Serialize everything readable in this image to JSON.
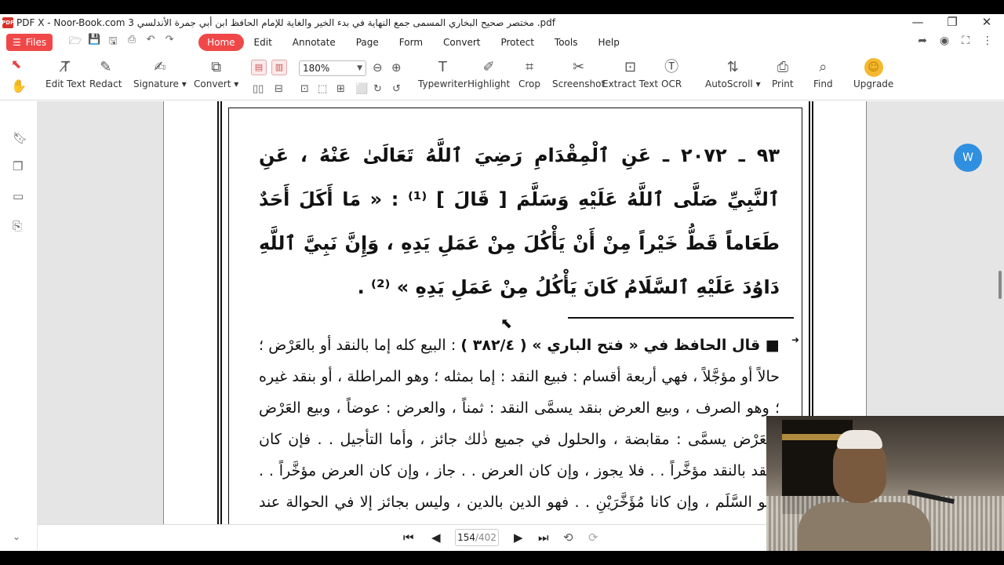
{
  "window": {
    "logo_text": "PDF",
    "title": "PDF X - Noor-Book.com  مختصر صحيح البخاري المسمى جمع النهاية في بدء الخير والغاية للإمام الحافظ ابن أبي جمرة الأندلسي 3 .pdf",
    "btn_min": "—",
    "btn_max": "❐",
    "btn_close": "✕"
  },
  "menubar": {
    "files_label": "Files",
    "items": [
      "Home",
      "Edit",
      "Annotate",
      "Page",
      "Form",
      "Convert",
      "Protect",
      "Tools",
      "Help"
    ],
    "active": "Home"
  },
  "toolbar": {
    "edit_text": "Edit Text",
    "redact": "Redact",
    "signature": "Signature ▾",
    "convert": "Convert ▾",
    "zoom": "180%",
    "typewriter": "Typewriter",
    "highlight": "Highlight",
    "crop": "Crop",
    "screenshot": "Screenshot",
    "extract_text": "Extract Text",
    "ocr": "OCR",
    "autoscroll": "AutoScroll ▾",
    "print": "Print",
    "find": "Find",
    "upgrade": "Upgrade"
  },
  "document": {
    "hadith": "٩٣ ـ ٢٠٧٢ ـ عَنِ ٱلْمِقْدَامِ رَضِيَ ٱللَّهُ تَعَالَىٰ عَنْهُ ، عَنِ ٱلنَّبِيِّ صَلَّى ٱللَّهُ عَلَيْهِ وَسَلَّمَ [ قَالَ ] ⁽¹⁾ : « مَا أَكَلَ أَحَدٌ طَعَاماً قَطُّ خَيْراً مِنْ أَنْ يَأْكُلَ مِنْ عَمَلِ يَدِهِ ، وَإِنَّ نَبِيَّ ٱللَّهِ دَاوُدَ عَلَيْهِ ٱلسَّلَامُ كَانَ يَأْكُلُ مِنْ عَمَلِ يَدِهِ » ⁽²⁾ .",
    "commentary_lead": "■ قال الحافظ في « فتح الباري » ( ٣٨٢/٤ )",
    "commentary": " : البيع كله إما بالنقد أو بالعَرْض ؛ حالاً أو مؤجَّلاً ، فهي أربعة أقسام : فبيع النقد : إما بمثله ؛ وهو المراطلة ، أو بنقد غيره ؛ وهو الصرف ، وبيع العرض بنقد يسمَّى النقد : ثمناً ، والعرض : عوضاً ، وبيع العَرْض بالعَرْض يسمَّى : مقابضة ، والحلول في جميع ذٰلك جائز ، وأما التأجيل . . فإن كان النقد بالنقد مؤخَّراً . . فلا يجوز ، وإن كان العرض . . جاز ، وإن كان العرض مؤخَّراً . . فهو السَّلَم ، وإن كانا مُؤَخَّرَيْنِ . . فهو الدين بالدين ، وليس بجائز إلا في الحوالة عند من يقول إنها بيع"
  },
  "navigation": {
    "current_page": "154",
    "total_pages": "/402"
  },
  "colors": {
    "accent": "#f04848",
    "canvas": "#e5e5e5",
    "float_button": "#2f8fe0"
  }
}
